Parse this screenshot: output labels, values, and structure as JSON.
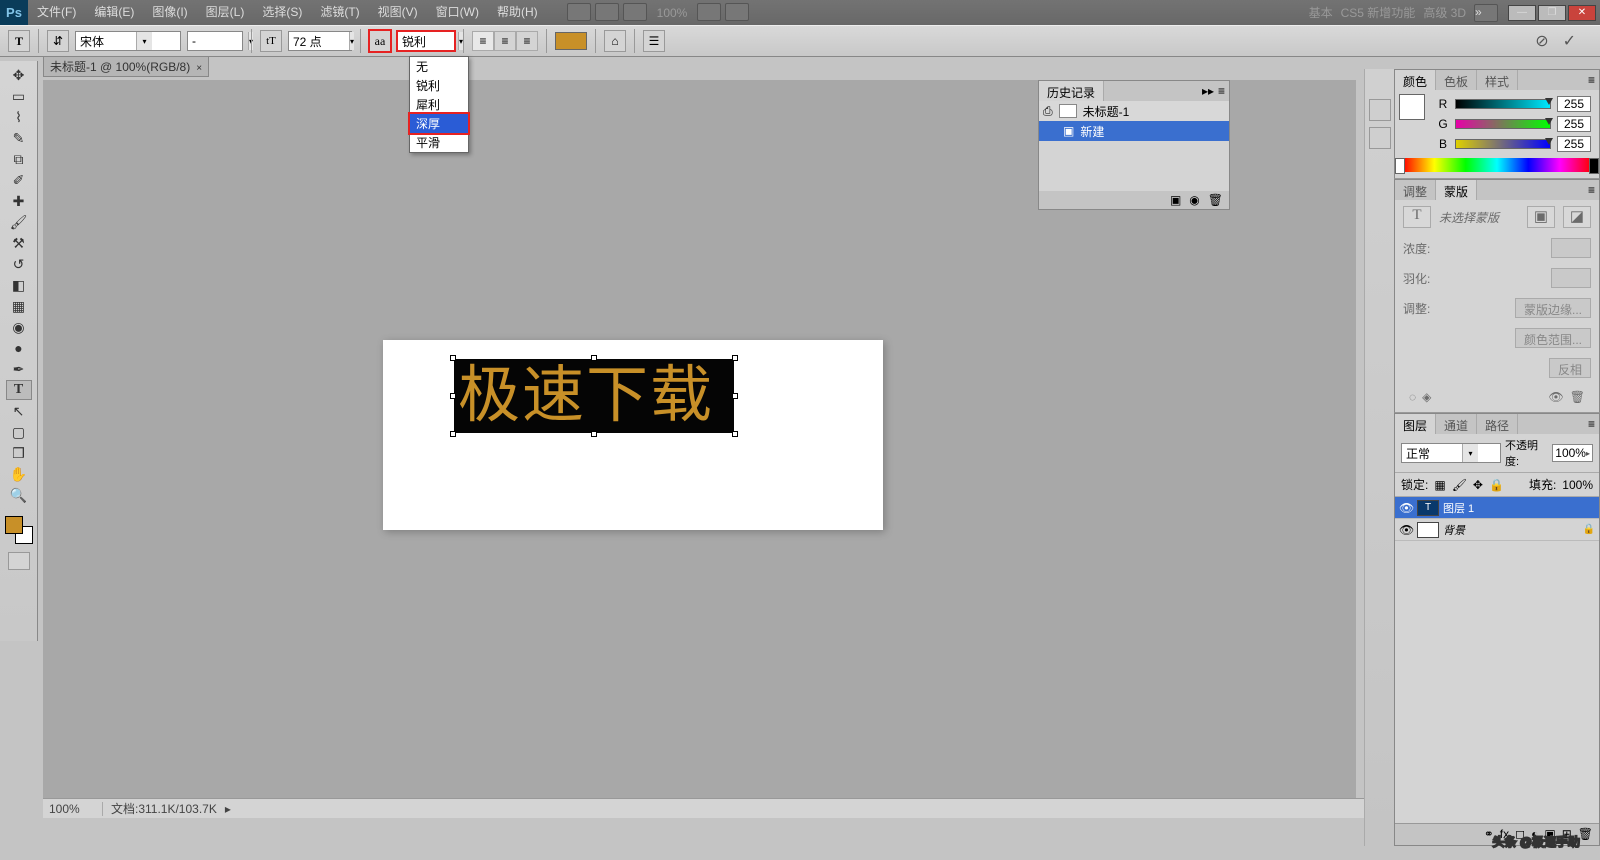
{
  "menubar": {
    "items": [
      "文件(F)",
      "编辑(E)",
      "图像(I)",
      "图层(L)",
      "选择(S)",
      "滤镜(T)",
      "视图(V)",
      "窗口(W)",
      "帮助(H)"
    ],
    "zoom_label": "100%",
    "right": [
      "基本",
      "CS5 新增功能",
      "高级 3D"
    ]
  },
  "options": {
    "font_family": "宋体",
    "font_style": "-",
    "font_size": "72 点",
    "aa_label": "aa",
    "aa_value": "锐利",
    "color": "#c89028",
    "dropdown": {
      "items": [
        "无",
        "锐利",
        "犀利",
        "深厚",
        "平滑"
      ],
      "highlight": "深厚"
    }
  },
  "doc_tab": "未标题-1 @ 100%(RGB/8)",
  "canvas_text": "极速下载",
  "history": {
    "title": "历史记录",
    "doc": "未标题-1",
    "step": "新建"
  },
  "color_panel": {
    "tabs": [
      "颜色",
      "色板",
      "样式"
    ],
    "channels": [
      {
        "l": "R",
        "v": "255"
      },
      {
        "l": "G",
        "v": "255"
      },
      {
        "l": "B",
        "v": "255"
      }
    ]
  },
  "adjust_panel": {
    "tabs": [
      "调整",
      "蒙版"
    ],
    "placeholder": "未选择蒙版",
    "rows": [
      "浓度:",
      "羽化:",
      "调整:"
    ],
    "buttons": [
      "蒙版边缘...",
      "颜色范围...",
      "反相"
    ]
  },
  "layers_panel": {
    "tabs": [
      "图层",
      "通道",
      "路径"
    ],
    "blend": "正常",
    "opacity_label": "不透明度:",
    "opacity": "100%",
    "lock_label": "锁定:",
    "fill_label": "填充:",
    "fill": "100%",
    "layers": [
      {
        "name": "图层 1",
        "type": "T",
        "sel": true
      },
      {
        "name": "背景",
        "type": "bg",
        "sel": false,
        "locked": true
      }
    ]
  },
  "status": {
    "zoom": "100%",
    "docsize": "文档:311.1K/103.7K"
  },
  "watermark": "头条 @极速手助"
}
